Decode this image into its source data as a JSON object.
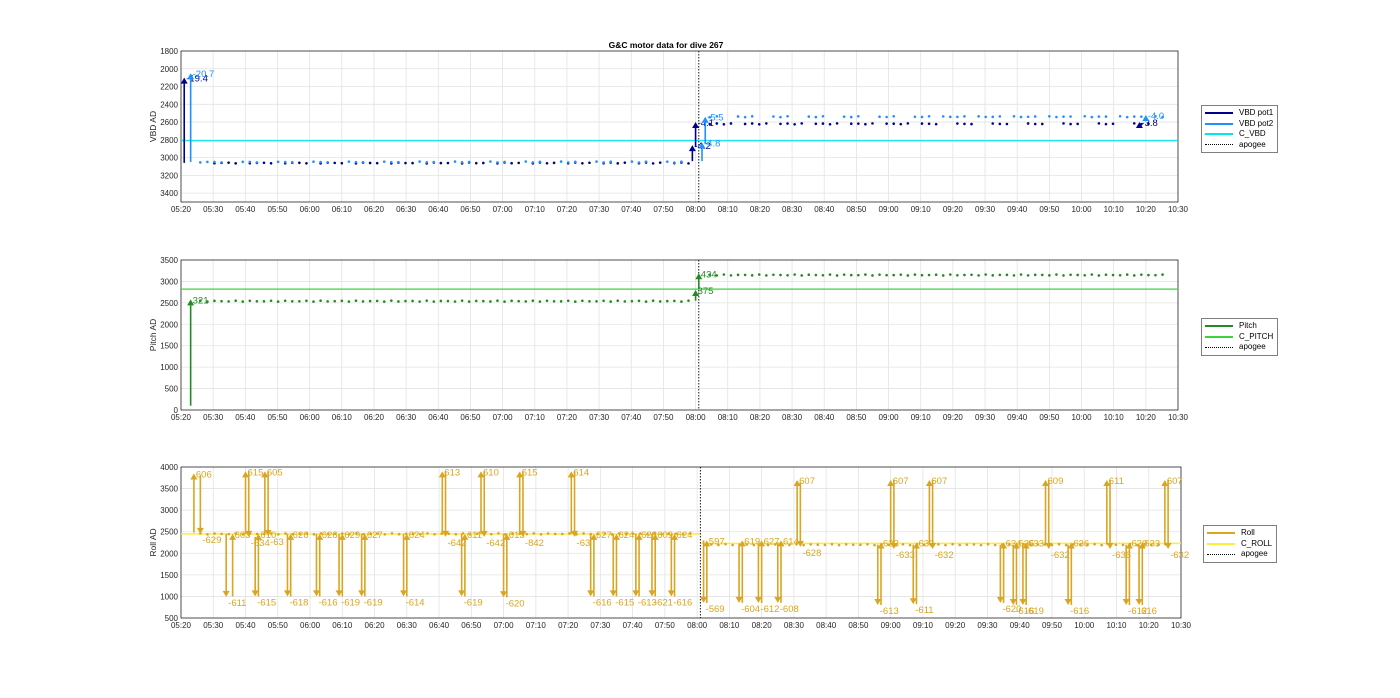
{
  "chart_data": [
    {
      "type": "line",
      "title": "G&C motor data for dive 267",
      "ylabel": "VBD AD",
      "xlim": [
        "05:20",
        "10:30"
      ],
      "ylim": [
        3500,
        1800
      ],
      "y_reversed": true,
      "xticks": [
        "05:20",
        "05:30",
        "05:40",
        "05:50",
        "06:00",
        "06:10",
        "06:20",
        "06:30",
        "06:40",
        "06:50",
        "07:00",
        "07:10",
        "07:20",
        "07:30",
        "07:40",
        "07:50",
        "08:00",
        "08:10",
        "08:20",
        "08:30",
        "08:40",
        "08:50",
        "09:00",
        "09:10",
        "09:20",
        "09:30",
        "09:40",
        "09:50",
        "10:00",
        "10:10",
        "10:20",
        "10:30"
      ],
      "yticks": [
        1800,
        2000,
        2200,
        2400,
        2600,
        2800,
        3000,
        3200,
        3400
      ],
      "grid": true,
      "legend_position": "outside-right",
      "apogee": "08:01",
      "series": [
        {
          "name": "VBD pot1",
          "color": "#00008b",
          "marker": "dot",
          "y_pre": 3060,
          "y_post": 2620
        },
        {
          "name": "VBD pot2",
          "color": "#1e90ff",
          "marker": "dot",
          "y_pre": 3050,
          "y_post": 2540
        },
        {
          "name": "C_VBD",
          "color": "#00e5ee",
          "style": "line",
          "y": 2810
        },
        {
          "name": "apogee",
          "color": "#000000",
          "style": "dotted"
        }
      ],
      "moves": [
        {
          "t": "05:21",
          "from": 3060,
          "to": 2100,
          "label": "-19.4",
          "color": "#00008b"
        },
        {
          "t": "05:23",
          "from": 3050,
          "to": 2050,
          "label": "-20.7",
          "color": "#1e90ff"
        },
        {
          "t": "07:59",
          "from": 3040,
          "to": 2860,
          "label": "-4.2",
          "color": "#00008b"
        },
        {
          "t": "08:00",
          "from": 2880,
          "to": 2600,
          "label": "-4.1",
          "color": "#00008b"
        },
        {
          "t": "08:02",
          "from": 3040,
          "to": 2830,
          "label": "-4.8",
          "color": "#1e90ff"
        },
        {
          "t": "08:03",
          "from": 2840,
          "to": 2540,
          "label": "-5.5",
          "color": "#1e90ff"
        },
        {
          "t": "10:18",
          "from": 2620,
          "to": 2600,
          "label": "-3.8",
          "color": "#00008b"
        },
        {
          "t": "10:20",
          "from": 2560,
          "to": 2520,
          "label": "-4.0",
          "color": "#1e90ff"
        }
      ]
    },
    {
      "type": "line",
      "ylabel": "Pitch AD",
      "xlim": [
        "05:20",
        "10:30"
      ],
      "ylim": [
        0,
        3500
      ],
      "xticks": [
        "05:20",
        "05:30",
        "05:40",
        "05:50",
        "06:00",
        "06:10",
        "06:20",
        "06:30",
        "06:40",
        "06:50",
        "07:00",
        "07:10",
        "07:20",
        "07:30",
        "07:40",
        "07:50",
        "08:00",
        "08:10",
        "08:20",
        "08:30",
        "08:40",
        "08:50",
        "09:00",
        "09:10",
        "09:20",
        "09:30",
        "09:40",
        "09:50",
        "10:00",
        "10:10",
        "10:20",
        "10:30"
      ],
      "yticks": [
        0,
        500,
        1000,
        1500,
        2000,
        2500,
        3000,
        3500
      ],
      "grid": true,
      "legend_position": "outside-right",
      "apogee": "08:01",
      "series": [
        {
          "name": "Pitch",
          "color": "#228b22",
          "marker": "dot",
          "y_pre": 2540,
          "y_post": 3150
        },
        {
          "name": "C_PITCH",
          "color": "#3cd33c",
          "style": "line",
          "y": 2820
        },
        {
          "name": "apogee",
          "color": "#000000",
          "style": "dotted"
        }
      ],
      "moves": [
        {
          "t": "05:23",
          "from": 100,
          "to": 2580,
          "label": "321",
          "color": "#228b22"
        },
        {
          "t": "08:00",
          "from": 2550,
          "to": 2800,
          "label": "375",
          "color": "#228b22"
        },
        {
          "t": "08:01",
          "from": 2830,
          "to": 3190,
          "label": "434",
          "color": "#228b22"
        }
      ]
    },
    {
      "type": "line",
      "ylabel": "Roll AD",
      "xlim": [
        "05:20",
        "10:30"
      ],
      "ylim": [
        500,
        4000
      ],
      "xticks": [
        "05:20",
        "05:30",
        "05:40",
        "05:50",
        "06:00",
        "06:10",
        "06:20",
        "06:30",
        "06:40",
        "06:50",
        "07:00",
        "07:10",
        "07:20",
        "07:30",
        "07:40",
        "07:50",
        "08:00",
        "08:10",
        "08:20",
        "08:30",
        "08:40",
        "08:50",
        "09:00",
        "09:10",
        "09:20",
        "09:30",
        "09:40",
        "09:50",
        "10:00",
        "10:10",
        "10:20",
        "10:30"
      ],
      "yticks": [
        500,
        1000,
        1500,
        2000,
        2500,
        3000,
        3500,
        4000
      ],
      "grid": true,
      "legend_position": "outside-right",
      "apogee": "08:01",
      "series": [
        {
          "name": "Roll",
          "color": "#daa520",
          "marker": "dot",
          "y_pre": 2450,
          "y_post": 2200
        },
        {
          "name": "C_ROLL",
          "color": "#ffec3d",
          "style": "line",
          "y_pre": 2450,
          "y_post": 2230
        },
        {
          "name": "apogee",
          "color": "#000000",
          "style": "dotted"
        }
      ],
      "moves": [
        {
          "t": "05:24",
          "from": 2480,
          "to": 3850,
          "label": "606"
        },
        {
          "t": "05:26",
          "from": 3800,
          "to": 2450,
          "label": "-629"
        },
        {
          "t": "05:34",
          "from": 2450,
          "to": 990,
          "label": "-611"
        },
        {
          "t": "05:36",
          "from": 1000,
          "to": 2450,
          "label": "603"
        },
        {
          "t": "05:40",
          "from": 2450,
          "to": 3900,
          "label": "615"
        },
        {
          "t": "05:41",
          "from": 3900,
          "to": 2380,
          "label": "-634"
        },
        {
          "t": "05:43",
          "from": 2380,
          "to": 1000,
          "label": "-615"
        },
        {
          "t": "05:44",
          "from": 1000,
          "to": 2450,
          "label": "610"
        },
        {
          "t": "05:46",
          "from": 2450,
          "to": 3900,
          "label": "605"
        },
        {
          "t": "05:47",
          "from": 3900,
          "to": 2400,
          "label": "-63"
        },
        {
          "t": "05:53",
          "from": 2450,
          "to": 1000,
          "label": "-618"
        },
        {
          "t": "05:54",
          "from": 1000,
          "to": 2450,
          "label": "626"
        },
        {
          "t": "06:02",
          "from": 2450,
          "to": 1000,
          "label": "-616"
        },
        {
          "t": "06:03",
          "from": 1000,
          "to": 2450,
          "label": "626"
        },
        {
          "t": "06:09",
          "from": 2450,
          "to": 1000,
          "label": "-619"
        },
        {
          "t": "06:10",
          "from": 1000,
          "to": 2450,
          "label": "629"
        },
        {
          "t": "06:16",
          "from": 2450,
          "to": 1000,
          "label": "-619"
        },
        {
          "t": "06:17",
          "from": 1000,
          "to": 2450,
          "label": "627"
        },
        {
          "t": "06:29",
          "from": 2450,
          "to": 1000,
          "label": "-614"
        },
        {
          "t": "06:30",
          "from": 1000,
          "to": 2450,
          "label": "624"
        },
        {
          "t": "06:41",
          "from": 2450,
          "to": 3900,
          "label": "613"
        },
        {
          "t": "06:42",
          "from": 3900,
          "to": 2380,
          "label": "-642"
        },
        {
          "t": "06:47",
          "from": 2450,
          "to": 1000,
          "label": "-619"
        },
        {
          "t": "06:48",
          "from": 1000,
          "to": 2450,
          "label": "611"
        },
        {
          "t": "06:53",
          "from": 2450,
          "to": 3900,
          "label": "610"
        },
        {
          "t": "06:54",
          "from": 3900,
          "to": 2380,
          "label": "-642"
        },
        {
          "t": "07:00",
          "from": 2450,
          "to": 980,
          "label": "-620"
        },
        {
          "t": "07:01",
          "from": 980,
          "to": 2450,
          "label": "613"
        },
        {
          "t": "07:05",
          "from": 2450,
          "to": 3900,
          "label": "615"
        },
        {
          "t": "07:06",
          "from": 3900,
          "to": 2380,
          "label": "-842"
        },
        {
          "t": "07:21",
          "from": 2450,
          "to": 3900,
          "label": "614"
        },
        {
          "t": "07:22",
          "from": 3900,
          "to": 2380,
          "label": "-63"
        },
        {
          "t": "07:27",
          "from": 2450,
          "to": 1000,
          "label": "-616"
        },
        {
          "t": "07:28",
          "from": 1000,
          "to": 2450,
          "label": "627"
        },
        {
          "t": "07:34",
          "from": 2450,
          "to": 1000,
          "label": "-615"
        },
        {
          "t": "07:35",
          "from": 1000,
          "to": 2450,
          "label": "624"
        },
        {
          "t": "07:41",
          "from": 2450,
          "to": 1000,
          "label": "-613"
        },
        {
          "t": "07:42",
          "from": 1000,
          "to": 2450,
          "label": "628"
        },
        {
          "t": "07:46",
          "from": 2450,
          "to": 1000,
          "label": "-621"
        },
        {
          "t": "07:47",
          "from": 1000,
          "to": 2450,
          "label": "609"
        },
        {
          "t": "07:52",
          "from": 2450,
          "to": 1000,
          "label": "-616"
        },
        {
          "t": "07:53",
          "from": 1000,
          "to": 2450,
          "label": "624"
        },
        {
          "t": "08:02",
          "from": 2300,
          "to": 850,
          "label": "-569"
        },
        {
          "t": "08:03",
          "from": 850,
          "to": 2300,
          "label": "597"
        },
        {
          "t": "08:13",
          "from": 2200,
          "to": 850,
          "label": "-604"
        },
        {
          "t": "08:14",
          "from": 850,
          "to": 2300,
          "label": "619"
        },
        {
          "t": "08:19",
          "from": 2250,
          "to": 850,
          "label": "-612"
        },
        {
          "t": "08:20",
          "from": 850,
          "to": 2300,
          "label": "627"
        },
        {
          "t": "08:25",
          "from": 2250,
          "to": 850,
          "label": "-608"
        },
        {
          "t": "08:26",
          "from": 850,
          "to": 2300,
          "label": "614"
        },
        {
          "t": "08:31",
          "from": 2250,
          "to": 3700,
          "label": "607"
        },
        {
          "t": "08:32",
          "from": 3650,
          "to": 2150,
          "label": "-628"
        },
        {
          "t": "08:56",
          "from": 2200,
          "to": 800,
          "label": "-613"
        },
        {
          "t": "08:57",
          "from": 800,
          "to": 2250,
          "label": "633"
        },
        {
          "t": "09:00",
          "from": 2200,
          "to": 3700,
          "label": "607"
        },
        {
          "t": "09:01",
          "from": 3700,
          "to": 2100,
          "label": "-633"
        },
        {
          "t": "09:07",
          "from": 2200,
          "to": 820,
          "label": "-611"
        },
        {
          "t": "09:08",
          "from": 820,
          "to": 2250,
          "label": "633"
        },
        {
          "t": "09:12",
          "from": 2200,
          "to": 3700,
          "label": "607"
        },
        {
          "t": "09:13",
          "from": 3700,
          "to": 2100,
          "label": "-632"
        },
        {
          "t": "09:34",
          "from": 2200,
          "to": 850,
          "label": "-620"
        },
        {
          "t": "09:35",
          "from": 850,
          "to": 2250,
          "label": "634"
        },
        {
          "t": "09:38",
          "from": 2200,
          "to": 800,
          "label": "-616"
        },
        {
          "t": "09:39",
          "from": 800,
          "to": 2250,
          "label": "635"
        },
        {
          "t": "09:41",
          "from": 2200,
          "to": 800,
          "label": "-619"
        },
        {
          "t": "09:42",
          "from": 800,
          "to": 2250,
          "label": "633"
        },
        {
          "t": "09:48",
          "from": 2200,
          "to": 3700,
          "label": "609"
        },
        {
          "t": "09:49",
          "from": 3700,
          "to": 2100,
          "label": "-632"
        },
        {
          "t": "09:55",
          "from": 2200,
          "to": 800,
          "label": "-616"
        },
        {
          "t": "09:56",
          "from": 800,
          "to": 2250,
          "label": "636"
        },
        {
          "t": "10:07",
          "from": 2200,
          "to": 3700,
          "label": "611"
        },
        {
          "t": "10:08",
          "from": 3700,
          "to": 2100,
          "label": "-636"
        },
        {
          "t": "10:13",
          "from": 2200,
          "to": 800,
          "label": "-612"
        },
        {
          "t": "10:14",
          "from": 800,
          "to": 2250,
          "label": "620"
        },
        {
          "t": "10:17",
          "from": 2200,
          "to": 800,
          "label": "616"
        },
        {
          "t": "10:18",
          "from": 800,
          "to": 2250,
          "label": "633"
        },
        {
          "t": "10:25",
          "from": 2200,
          "to": 3700,
          "label": "607"
        },
        {
          "t": "10:26",
          "from": 3700,
          "to": 2100,
          "label": "-632"
        }
      ]
    }
  ]
}
